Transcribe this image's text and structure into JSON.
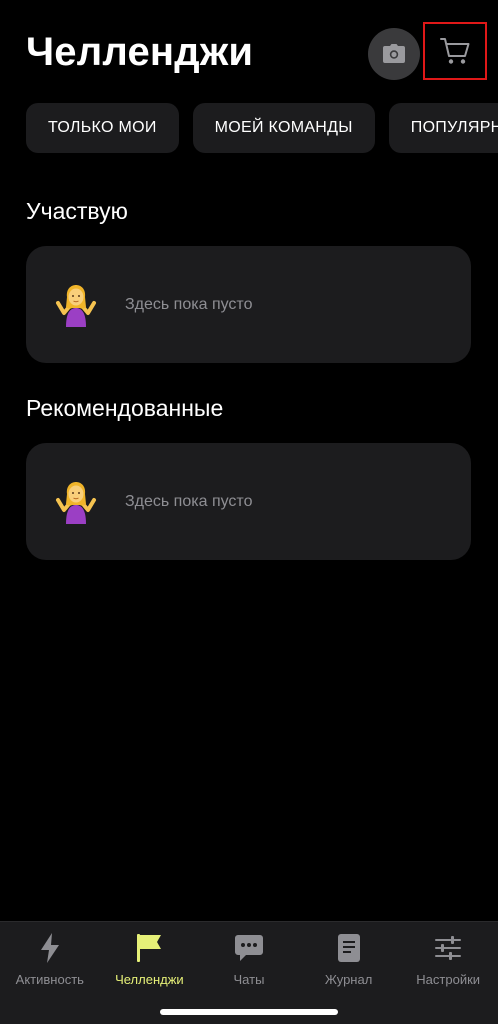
{
  "header": {
    "title": "Челленджи"
  },
  "filters": [
    {
      "label": "ТОЛЬКО МОИ"
    },
    {
      "label": "МОЕЙ КОМАНДЫ"
    },
    {
      "label": "ПОПУЛЯРНЫЕ"
    }
  ],
  "sections": {
    "participating": {
      "title": "Участвую",
      "empty_text": "Здесь пока пусто"
    },
    "recommended": {
      "title": "Рекомендованные",
      "empty_text": "Здесь пока пусто"
    }
  },
  "tabbar": {
    "items": [
      {
        "label": "Активность",
        "icon": "lightning-icon",
        "active": false
      },
      {
        "label": "Челленджи",
        "icon": "flag-icon",
        "active": true
      },
      {
        "label": "Чаты",
        "icon": "chat-bubble-icon",
        "active": false
      },
      {
        "label": "Журнал",
        "icon": "journal-icon",
        "active": false
      },
      {
        "label": "Настройки",
        "icon": "sliders-icon",
        "active": false
      }
    ]
  },
  "colors": {
    "background": "#000000",
    "card": "#1c1c1e",
    "active_tab": "#e6f078",
    "inactive_tab": "#8e8e93",
    "highlight_border": "#e01818"
  }
}
